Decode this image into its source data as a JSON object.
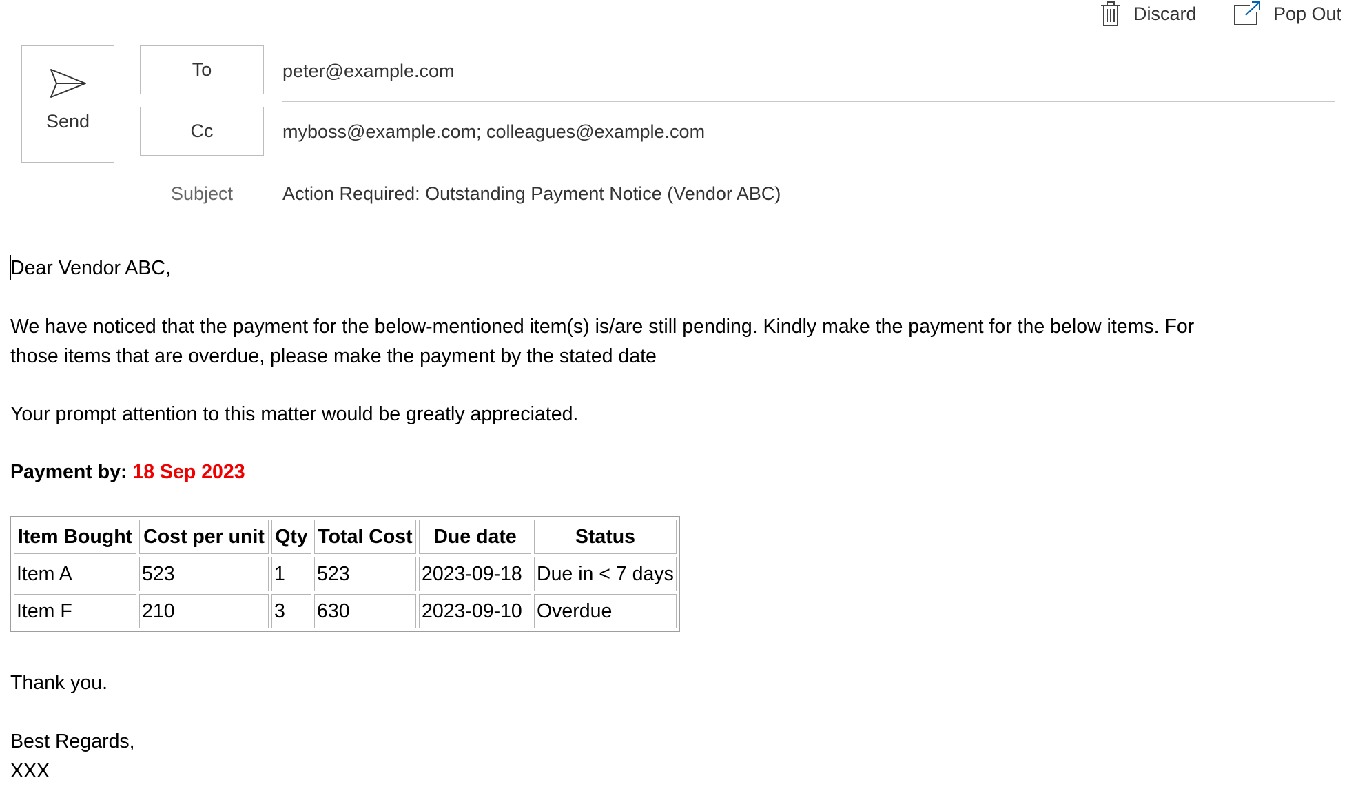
{
  "toolbar": {
    "discard_label": "Discard",
    "pop_out_label": "Pop Out",
    "send_label": "Send"
  },
  "fields": {
    "to_label": "To",
    "to_value": "peter@example.com",
    "cc_label": "Cc",
    "cc_value": "myboss@example.com; colleagues@example.com",
    "subject_label": "Subject",
    "subject_value": "Action Required: Outstanding Payment Notice (Vendor ABC)"
  },
  "message": {
    "greeting": "Dear Vendor ABC,",
    "paragraph1_line1": "We have noticed that the payment for the below-mentioned item(s) is/are still pending. Kindly make the payment for the below items. For",
    "paragraph1_line2": "those items that are overdue, please make the payment by the stated date",
    "paragraph2": "Your prompt attention to this matter would be greatly appreciated.",
    "payment_by_label": "Payment by:",
    "payment_by_date": "18 Sep 2023",
    "table": {
      "headers": [
        "Item Bought",
        "Cost per unit",
        "Qty",
        "Total Cost",
        "Due date",
        "Status"
      ],
      "rows": [
        [
          "Item A",
          "523",
          "1",
          "523",
          "2023-09-18",
          "Due in < 7 days"
        ],
        [
          "Item F",
          "210",
          "3",
          "630",
          "2023-09-10",
          "Overdue"
        ]
      ]
    },
    "thanks": "Thank you.",
    "closing": "Best Regards,",
    "signature": "XXX"
  },
  "colors": {
    "accent_red": "#ee0000",
    "border": "#bdbdbd",
    "text_secondary": "#333333"
  },
  "icons": {
    "discard": "trash-icon",
    "pop_out": "pop-out-icon",
    "send": "send-icon"
  }
}
